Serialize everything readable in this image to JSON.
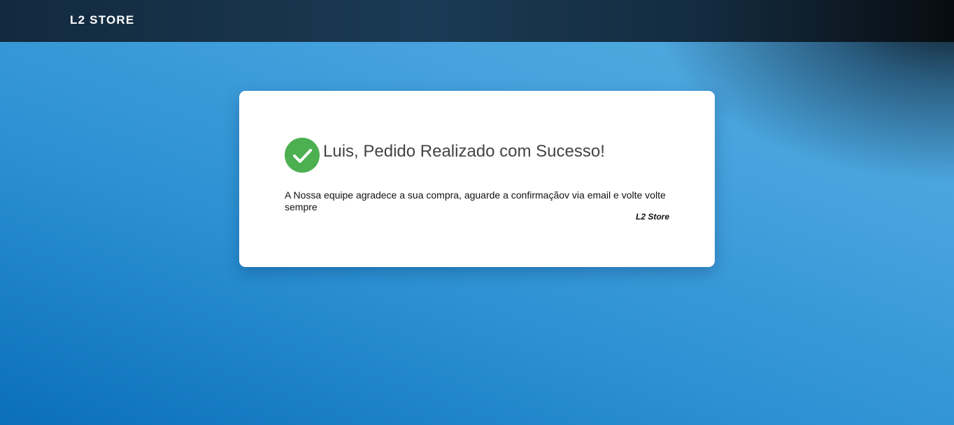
{
  "header": {
    "brand": "L2 STORE"
  },
  "confirmation": {
    "icon": "check-circle-icon",
    "icon_color": "#4caf50",
    "title": "Luis, Pedido Realizado com Sucesso!",
    "message": "A Nossa equipe agradece a sua compra, aguarde a confirmaçãov via email e volte volte sempre",
    "signature": "L2 Store"
  },
  "colors": {
    "background_accent": "#2a8fd2",
    "header_bg": "#13293d",
    "card_bg": "#ffffff"
  }
}
